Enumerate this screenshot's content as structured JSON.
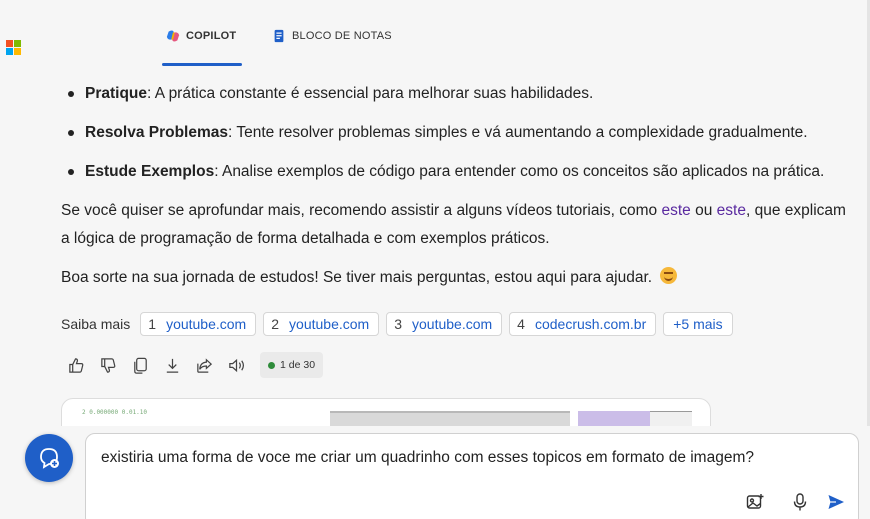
{
  "header": {
    "tabs": [
      {
        "label": "COPILOT",
        "icon": "copilot-icon",
        "active": true
      },
      {
        "label": "BLOCO DE NOTAS",
        "icon": "notebook-icon",
        "active": false
      }
    ]
  },
  "content": {
    "bullets": [
      {
        "term": "Pratique",
        "text": ": A prática constante é essencial para melhorar suas habilidades."
      },
      {
        "term": "Resolva Problemas",
        "text": ": Tente resolver problemas simples e vá aumentando a complexidade gradualmente."
      },
      {
        "term": "Estude Exemplos",
        "text": ": Analise exemplos de código para entender como os conceitos são aplicados na prática."
      }
    ],
    "para1": {
      "before": "Se você quiser se aprofundar mais, recomendo assistir a alguns vídeos tutoriais, como ",
      "link1": "este",
      "middle": " ou ",
      "link2": "este",
      "after": ", que explicam a lógica de programação de forma detalhada e com exemplos práticos."
    },
    "para2": "Boa sorte na sua jornada de estudos! Se tiver mais perguntas, estou aqui para ajudar."
  },
  "sources": {
    "label": "Saiba mais",
    "items": [
      {
        "num": "1",
        "site": "youtube.com"
      },
      {
        "num": "2",
        "site": "youtube.com"
      },
      {
        "num": "3",
        "site": "youtube.com"
      },
      {
        "num": "4",
        "site": "codecrush.com.br"
      }
    ],
    "more": "+5 mais"
  },
  "actions": {
    "icons": [
      "thumbs-up-icon",
      "thumbs-down-icon",
      "copy-icon",
      "download-icon",
      "share-icon",
      "speaker-icon"
    ],
    "counter": "1 de 30"
  },
  "preview": {
    "snippet": "2  0.000000 0.01.10"
  },
  "input": {
    "value": "existiria uma forma de voce me criar um quadrinho com esses topicos em formato de imagem?"
  },
  "colors": {
    "accent": "#1f5fc8",
    "link_purple": "#5a2aa0",
    "status_green": "#2e8b3a"
  }
}
